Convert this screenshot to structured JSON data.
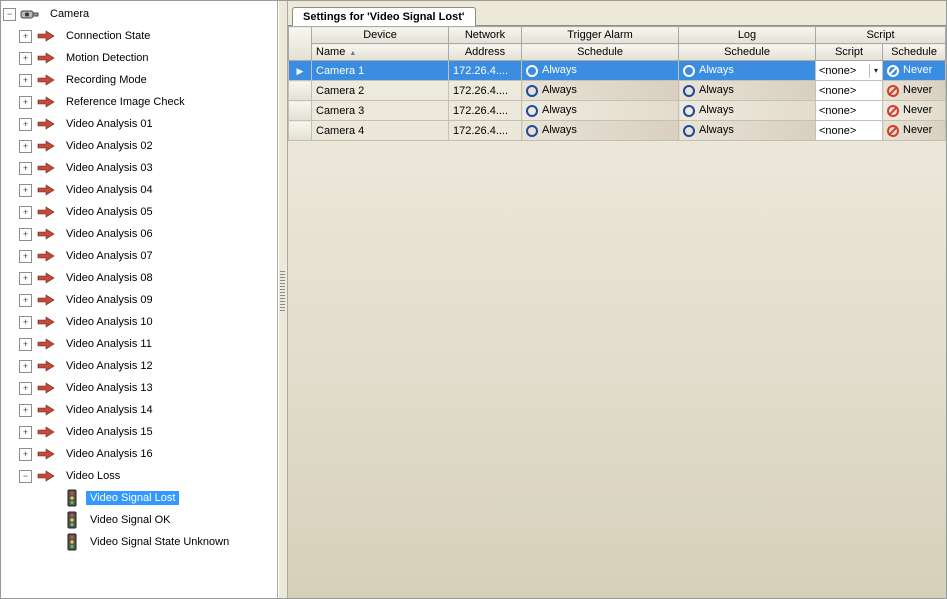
{
  "tree": {
    "root": "Camera",
    "items": [
      {
        "label": "Connection State",
        "icon": "arrow"
      },
      {
        "label": "Motion Detection",
        "icon": "arrow"
      },
      {
        "label": "Recording Mode",
        "icon": "arrow"
      },
      {
        "label": "Reference Image Check",
        "icon": "arrow"
      },
      {
        "label": "Video Analysis 01",
        "icon": "arrow"
      },
      {
        "label": "Video Analysis 02",
        "icon": "arrow"
      },
      {
        "label": "Video Analysis 03",
        "icon": "arrow"
      },
      {
        "label": "Video Analysis 04",
        "icon": "arrow"
      },
      {
        "label": "Video Analysis 05",
        "icon": "arrow"
      },
      {
        "label": "Video Analysis 06",
        "icon": "arrow"
      },
      {
        "label": "Video Analysis 07",
        "icon": "arrow"
      },
      {
        "label": "Video Analysis 08",
        "icon": "arrow"
      },
      {
        "label": "Video Analysis 09",
        "icon": "arrow"
      },
      {
        "label": "Video Analysis 10",
        "icon": "arrow"
      },
      {
        "label": "Video Analysis 11",
        "icon": "arrow"
      },
      {
        "label": "Video Analysis 12",
        "icon": "arrow"
      },
      {
        "label": "Video Analysis 13",
        "icon": "arrow"
      },
      {
        "label": "Video Analysis 14",
        "icon": "arrow"
      },
      {
        "label": "Video Analysis 15",
        "icon": "arrow"
      },
      {
        "label": "Video Analysis 16",
        "icon": "arrow"
      },
      {
        "label": "Video Loss",
        "icon": "arrow",
        "expanded": true,
        "children": [
          {
            "label": "Video Signal Lost",
            "icon": "traffic",
            "selected": true
          },
          {
            "label": "Video Signal OK",
            "icon": "traffic"
          },
          {
            "label": "Video Signal State Unknown",
            "icon": "traffic"
          }
        ]
      }
    ]
  },
  "tab_title": "Settings for 'Video Signal Lost'",
  "headers": {
    "row1": {
      "device": "Device",
      "network": "Network",
      "trigger": "Trigger Alarm",
      "log": "Log",
      "script": "Script"
    },
    "row2": {
      "name": "Name",
      "address": "Address",
      "trig_sched": "Schedule",
      "log_sched": "Schedule",
      "script_col": "Script",
      "script_sched": "Schedule"
    }
  },
  "rows": [
    {
      "name": "Camera 1",
      "address": "172.26.4....",
      "trigger": "Always",
      "log": "Always",
      "script": "<none>",
      "script_sched": "Never",
      "selected": true
    },
    {
      "name": "Camera 2",
      "address": "172.26.4....",
      "trigger": "Always",
      "log": "Always",
      "script": "<none>",
      "script_sched": "Never"
    },
    {
      "name": "Camera 3",
      "address": "172.26.4....",
      "trigger": "Always",
      "log": "Always",
      "script": "<none>",
      "script_sched": "Never"
    },
    {
      "name": "Camera 4",
      "address": "172.26.4....",
      "trigger": "Always",
      "log": "Always",
      "script": "<none>",
      "script_sched": "Never"
    }
  ]
}
